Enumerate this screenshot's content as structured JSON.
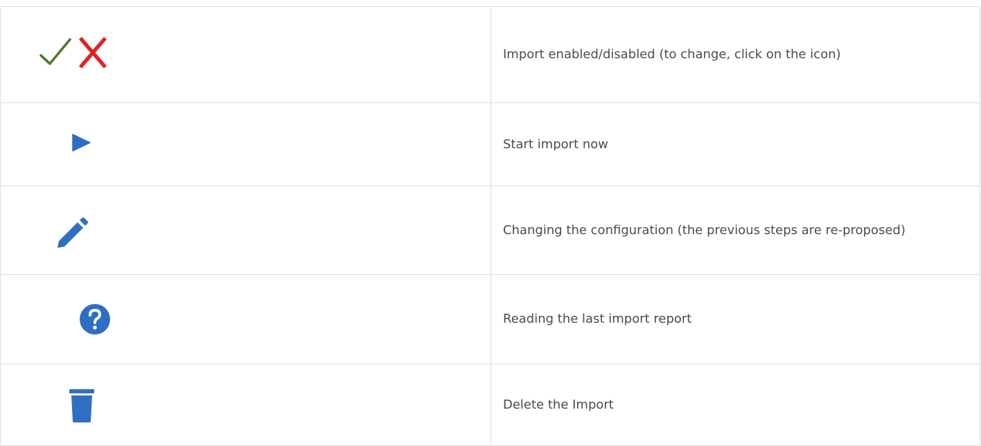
{
  "legend": {
    "rows": [
      {
        "icons": [
          "check-icon",
          "x-icon"
        ],
        "description": "Import enabled/disabled (to change, click on the icon)"
      },
      {
        "icons": [
          "play-icon"
        ],
        "description": "Start import now"
      },
      {
        "icons": [
          "pencil-icon"
        ],
        "description": "Changing the configuration (the previous steps are re-proposed)"
      },
      {
        "icons": [
          "question-circle-icon"
        ],
        "description": "Reading the last import report"
      },
      {
        "icons": [
          "trash-icon"
        ],
        "description": "Delete the Import"
      }
    ]
  },
  "colors": {
    "enabled_green": "#4e7a2c",
    "disabled_red": "#e02424",
    "icon_blue": "#2f6fc3",
    "border": "#dcdcdc",
    "text": "#4b4b4b"
  }
}
